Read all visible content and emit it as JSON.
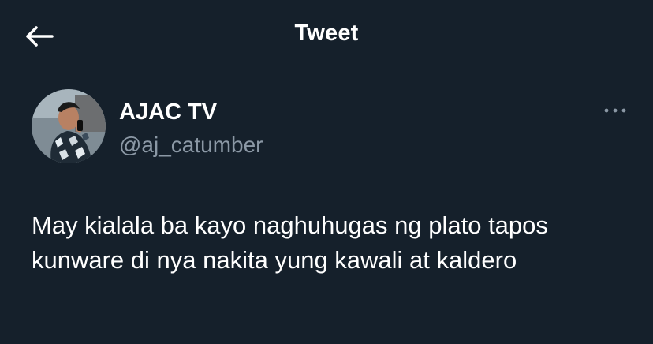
{
  "header": {
    "title": "Tweet",
    "back_icon": "arrow-left-icon"
  },
  "tweet": {
    "author": {
      "display_name": "AJAC TV",
      "handle": "@aj_catumber",
      "avatar_icon": "user-avatar"
    },
    "text": "May kialala ba kayo naghuhugas ng plato tapos kunware di nya nakita yung kawali at kaldero",
    "more_icon": "more-horizontal-icon"
  },
  "colors": {
    "background": "#15202b",
    "primary_text": "#ffffff",
    "secondary_text": "#8b98a5"
  }
}
